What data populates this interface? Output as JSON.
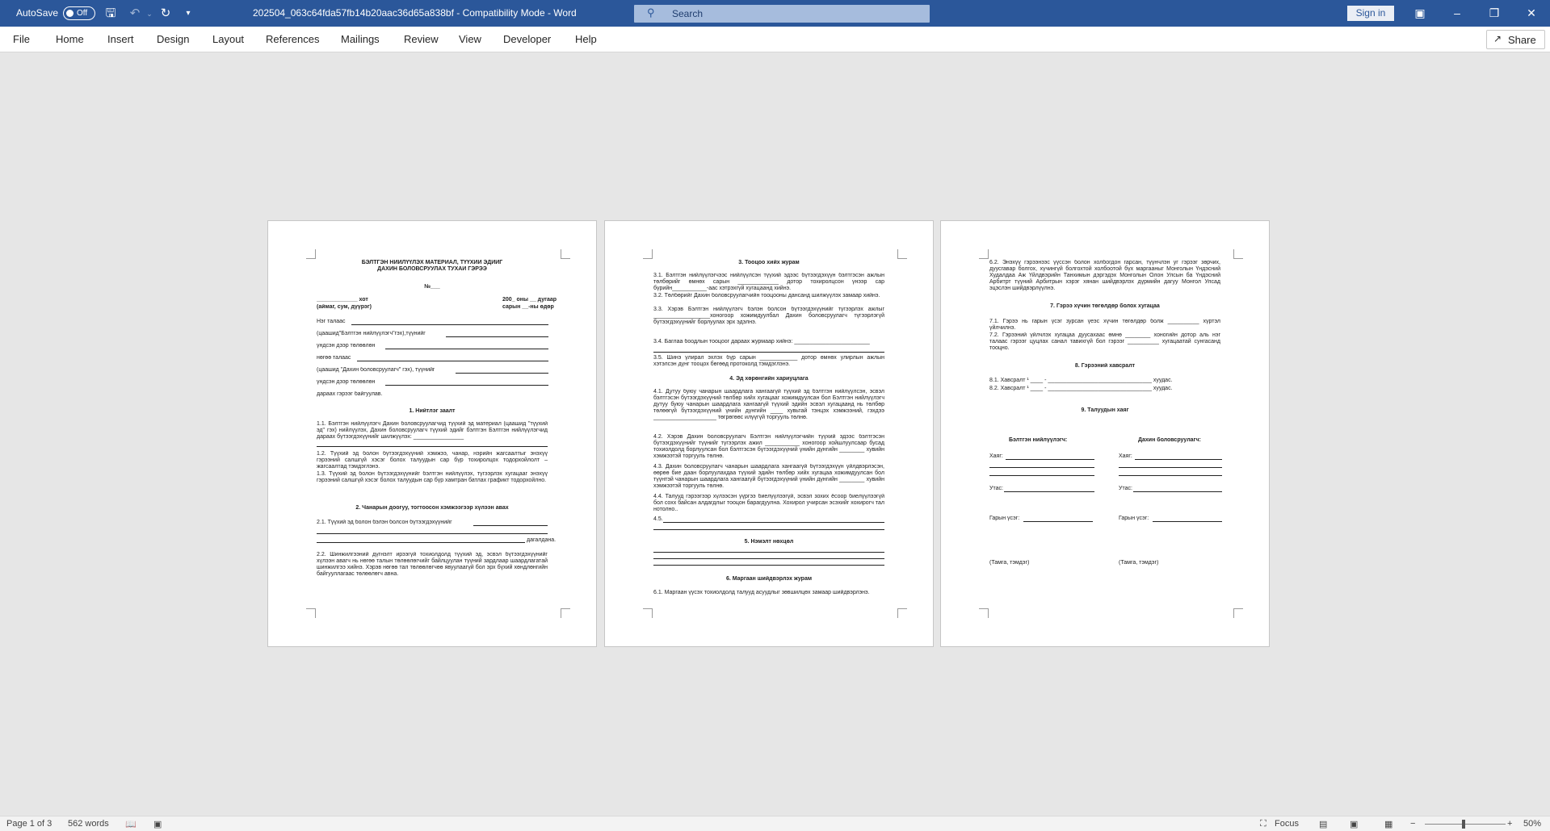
{
  "titlebar": {
    "autosave_label": "AutoSave",
    "autosave_state": "Off",
    "doc_title": "202504_063c64fda57fb14b20aac36d65a838bf  -  Compatibility Mode  -  Word",
    "search_placeholder": "Search",
    "signin_label": "Sign in"
  },
  "ribbon": {
    "tabs": [
      "File",
      "Home",
      "Insert",
      "Design",
      "Layout",
      "References",
      "Mailings",
      "Review",
      "View",
      "Developer",
      "Help"
    ],
    "share_label": "Share"
  },
  "page1": {
    "title1": "БЭЛТГЭН НИЙЛҮҮЛЭХ МАТЕРИАЛ, ТҮҮХИЙ ЭДИЙГ",
    "title2": "ДАХИН БОЛОВСРУУЛАХ ТУХАЙ ГЭРЭЭ",
    "number": "№___",
    "city": "_____________ хот",
    "city_sub": "(аймаг, сум, дүүрэг)",
    "date": "200_ оны __ дугаар",
    "date_sub": "сарын __-ны өдөр",
    "l1": "Нэг талаас",
    "l2": "(цаашид\"Бэлтгэн нийлүүлэгч\"гэх),түүнийг",
    "l3": "үндсэн дээр төлөөлөн",
    "l4": "нөгөө талаас",
    "l5": "(цаашид \"Дахин боловсруулагч\" гэх),  түүнийг",
    "l6": "үндсэн дээр төлөөлөн",
    "l7": "дараах гэрээг байгуулав.",
    "h1": "1. Нийтлэг заалт",
    "p11": "1.1.  Бэлтгэн нийлүүлэгч Дахин боловсруулагчид түүхий эд материал (цаашид \"түүхий эд\" гэх) нийлүүлэх, Дахин боловсруулагч түүхий эдийг бэлтгэн Бэлтгэн нийлүүлэгчид дараах бүтээгдэхүүнийг шилжүүлэх: ________________",
    "p12": "1.2. Түүхий эд болон бүтээгдэхүүний хэмжээ, чанар, нэрийн жагсаалтыг энэхүү гэрээний салшгүй хэсэг болох талуудын сар бүр тохиролцох тодорхойлолт – жагсаалтад тэмдэглэнэ.",
    "p13": "1.3. Түүхий эд болон бүтээгдэхүүнийг бэлтгэн нийлүүлэх, түгээрлэх хугацааг энэхүү гэрээний салшгүй хэсэг болох талуудын сар бүр хамтран батлах графикт тодорхойлно.",
    "h2": "2. Чанарын доогуу, тогтоосон хэмжээгээр хүлээн авах",
    "p21": "2.1. Түүхий эд болон бэлэн болсон бүтээгдэхүүнийг",
    "p21b": "дагалдана.",
    "p22": "2.2.  Шинжилгээний дүгнэлт ирээгүй тохиолдолд түүхий эд, эсвэл бүтээгдэхүүнийг хүлээн авагч нь нөгөө талын төлөөлөгчийг байлцуулан түүний зардлаар шаардлагатай шинжилгээ хийнэ. Хэрэв нөгөө тал төлөөлөгчөө явуулаагүй бол эрх бүхий хөндлөнгийн байгууллагаас төлөөлөгч авна."
  },
  "page2": {
    "h3": "3. Тооцоо хийх журам",
    "p31": "3.1.  Бэлтгэн нийлүүлэгчээс нийлүүлсэн түүхий эдээс бүтээгдэхүүн бэлтгэсэн ажлын  төлбөрийг өмнөх сарын _____________ дотор тохиролцсон үнээр сар бүрийн___________-ааc хэтрэхгүй хугацаанд хийнэ.",
    "p32": "3.2. Төлбөрийг Дахин боловсруулагчийн тооцооны дансанд шилжүүлэх замаар хийнэ.",
    "p33": "3.3. Хэрэв Бэлтгэн нийлүүлэгч бэлэн болсон бүтээгдэхүүнийг түгээрлэх ажлыг __________________хоногоор хожимдуулбал Дахин боловсруулагч түгээрлэгүй бүтээгдэхүүнийг борлуулах эрх эдэлнэ.",
    "p34": "3.4. Баглаа боодлын тооцоог дараах журмаар хийнэ: ________________________",
    "p35": "3.5. Шинэ үлирал эхлэх бүр сарын ____________ дотор өмнөх улирлын ажлын хэтэлсэн дүнг тооцох бөгөөд протоколд тэмдэглэнэ.",
    "h4": "4. Эд хөрөнгийн хариуцлага",
    "p41": "4.1. Дутуу буюу чанарын шаардлага хангаагүй түүхий эд бэлтгэн нийлүүлсэн, эсвэл бэлтгэсэн бүтээгдэхүүний төлбөр хийх хугацааг хожимдуулсан бол Бэлтгэн нийлүүлэгч дутуу буюу чанарын шаардлага хангаагүй түүхий эдийн эсвэл хугацаанд нь төлбөр төлөөгүй бүтээгдэхүүний үнийн дүнгийн ____ хувьтай тэнцэх хэмжээний, гэхдээ ____________________ төгрөгөөс илүүгүй торгууль төлнө.",
    "p42": "4.2. Хэрэв Дахин боловсруулагч Бэлтгэн нийлүүлэгчийн түүхий эдээс бэлтгэсэн бүтээгдэхүүнийг түүнийг түгээрлэх ажил ___________ хоногоор хойшлуулсаар бусад тохиолдолд борлуулсан бол бэлтгэсэн бүтээгдэхүүний үнийн дүнгийн ________ хувийн хэмжээтэй торгууль төлнө.",
    "p43": "4.3.  Дахин боловсруулагч чанарын шаардлага хангаагүй бүтээгдэхүүн үйлдвэрлэсэн, өөрөө бие даан борлуулахдаа түүхий эдийн төлбөр хийх хугацаа хожимдуулсан бол түүнтэй чанарын шаардлага хангаагүй бүтээгдэхүүний үнийн дүнгийн ________ хувийн хэмжээтэй торгууль төлнө.",
    "p44": "4.4. Талууд гэрээгээр хүлээсэн үүргээ биелүүлээгүй, эсвэл зохих ёсоор биелүүлээгүй бол сохх байсан алдагдлыг тооцон барагдуулна. Хохирол учирсан эсэхийг хохирогч тал нотолно..",
    "p45": "4.5.",
    "h5": "5. Нэмэлт нөхцөл",
    "h6": "6.  Маргаан шийдвэрлэх журам",
    "p61": "6.1.  Маргаан үүсэх тохиолдолд талууд асуудлыг зөвшилцөх замаар шийдвэрлэнэ."
  },
  "page3": {
    "p62": "6.2. Энэхүү гэрээнээс үүссэн болон холбогдон гарсан, түүнчлэн уг гэрээг зөрчих, дуусгавар болгох, хүчингүй болгохтой холбоотой бүх маргааныг Монголын Үндэсний Худалдаа Аж Үйлдвэрийн Танхимын дэргэдэх Монголын Олон Улсын ба Үндэсний Арбитрт түүний Арбитрын хэрэг хянан шийдвэрлэх дүрмийн дагуу Монгол Улсад эцэслэн шийдвэрлүүлнэ.",
    "h7": "7. Гэрээ хүчин төгөлдөр болох хугацаа",
    "p71": "7.1.  Гэрээ нь гарын үсэг зурсан үеэс хүчин төгөлдөр болж __________ хүртэл үйлчилнэ.",
    "p72": "7.2. Гэрээний үйлчлэх хугацаа дуусахаас өмнө ________ хоногийн дотор аль нэг талаас гэрээг цуцлах санал тавихгүй бол гэрээг __________ хугацаатай сунгасанд тооцно.",
    "h8": "8. Гэрээний хавсралт",
    "p81": "8.1. Хавсралт ¹ ____ - _________________________________ хуудас.",
    "p82": "8.2. Хавсралт ¹ ____ - _________________________________ хуудас.",
    "h9": "9. Талуудын хаяг",
    "supplier": "Бэлтгэн нийлүүлэгч:",
    "processor": "Дахин боловсруулагч:",
    "address": "Хаяг:",
    "phone": "Утас:",
    "signature": "Гарын үсэг:",
    "stamp": "(Тамга, тэмдэг)"
  },
  "statusbar": {
    "page": "Page 1 of 3",
    "words": "562 words",
    "focus": "Focus",
    "zoom": "50%"
  }
}
